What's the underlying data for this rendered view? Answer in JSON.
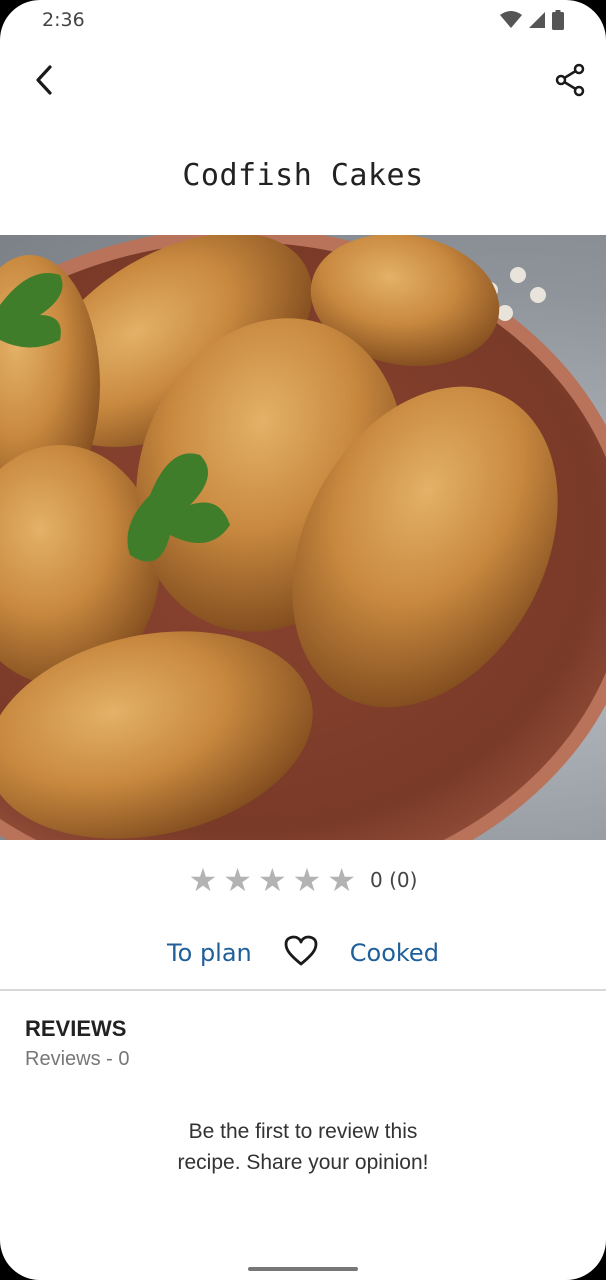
{
  "status_bar": {
    "time": "2:36",
    "icons": [
      "wifi-icon",
      "cell-signal-icon",
      "battery-icon"
    ]
  },
  "app_bar": {
    "back_icon": "chevron-left-icon",
    "share_icon": "share-icon"
  },
  "recipe": {
    "title": "Codfish Cakes",
    "image": "photo of fried codfish cakes with cilantro on a terracotta plate"
  },
  "rating": {
    "stars_total": 5,
    "stars_filled": 0,
    "text": "0 (0)"
  },
  "actions": {
    "to_plan": "To plan",
    "favorite_icon": "heart-outline-icon",
    "cooked": "Cooked"
  },
  "reviews": {
    "heading": "REVIEWS",
    "count_label": "Reviews - 0",
    "empty_line1": "Be the first to review this",
    "empty_line2": "recipe. Share your opinion!"
  },
  "colors": {
    "accent": "#1f5f9a",
    "star_inactive": "#b3b3b3",
    "divider": "#d8d8d8"
  }
}
